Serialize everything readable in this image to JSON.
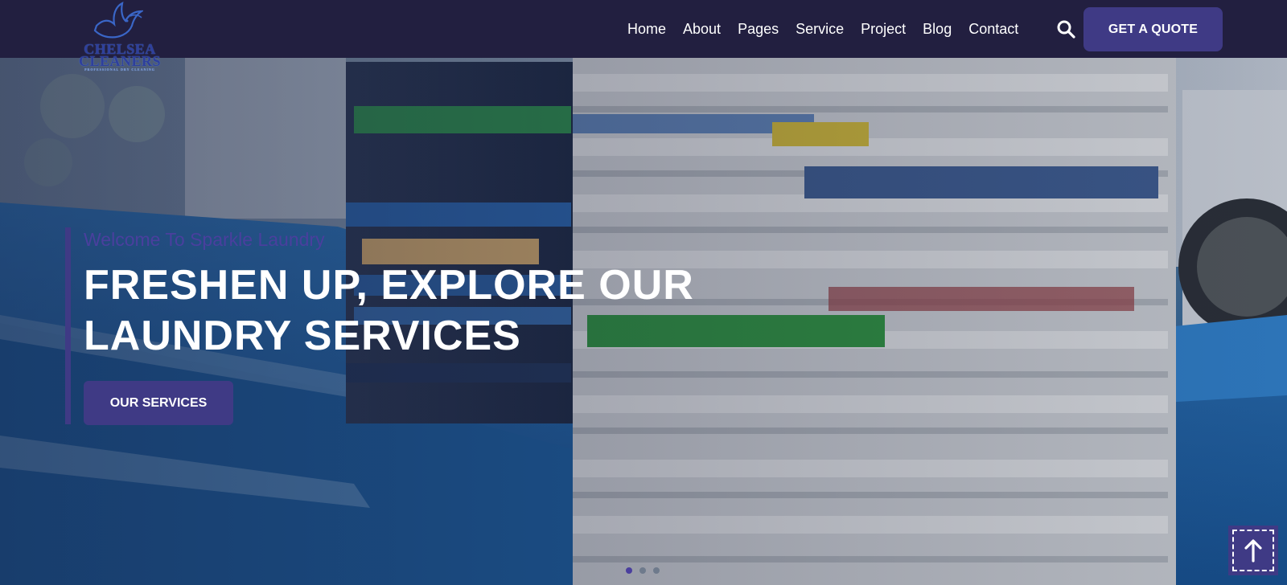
{
  "header": {
    "logo": {
      "text_line1": "CHELSEA",
      "text_line2": "CLEANERS",
      "tagline": "PROFESSIONAL DRY CLEANING"
    },
    "nav": [
      {
        "label": "Home"
      },
      {
        "label": "About"
      },
      {
        "label": "Pages"
      },
      {
        "label": "Service"
      },
      {
        "label": "Project"
      },
      {
        "label": "Blog"
      },
      {
        "label": "Contact"
      }
    ],
    "search_icon": "search-icon",
    "quote_button": "GET A QUOTE"
  },
  "hero": {
    "welcome": "Welcome To Sparkle Laundry",
    "title_line1": "FRESHEN UP, EXPLORE OUR",
    "title_line2": "LAUNDRY SERVICES",
    "cta": "OUR SERVICES",
    "slides_total": 3,
    "active_slide": 1
  },
  "scroll_top": {
    "icon": "arrow-up-icon"
  },
  "colors": {
    "header_bg": "#221f40",
    "accent": "#3f3a85",
    "welcome_text": "#4a3f9e",
    "white": "#ffffff"
  }
}
